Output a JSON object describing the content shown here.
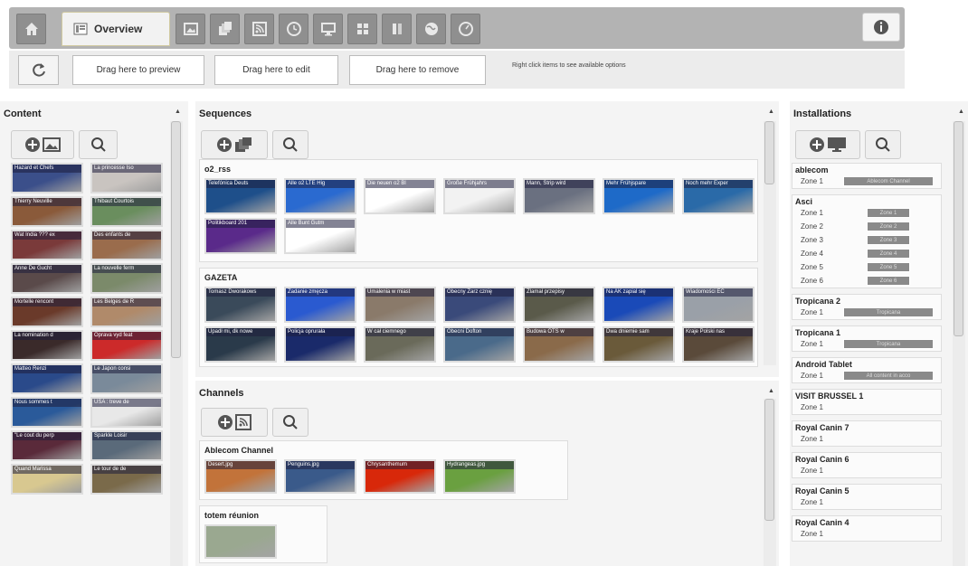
{
  "toolbar": {
    "overview_label": "Overview"
  },
  "drag": {
    "preview": "Drag here to preview",
    "edit": "Drag here to edit",
    "remove": "Drag here to remove",
    "hint": "Right click items to see available options"
  },
  "content": {
    "title": "Content",
    "items": [
      {
        "cap": "Hazard et Chefs",
        "c": "#3b4f8a"
      },
      {
        "cap": "La princesse Iso",
        "c": "#c9c4c0"
      },
      {
        "cap": "Thierry Neuville",
        "c": "#8a5a3a"
      },
      {
        "cap": "Thibaut Courtois",
        "c": "#6a8e5e"
      },
      {
        "cap": "Wat India ??? ex",
        "c": "#7a3a3a"
      },
      {
        "cap": "Des enfants de",
        "c": "#9a6c4c"
      },
      {
        "cap": "Anne De Gucht",
        "c": "#5a4a4a"
      },
      {
        "cap": "La nouvelle ferm",
        "c": "#7b8a6a"
      },
      {
        "cap": "Mortelle rencont",
        "c": "#6a3a2a"
      },
      {
        "cap": "Les Belges de R",
        "c": "#b08a6a"
      },
      {
        "cap": "La nomination d",
        "c": "#3a2a2a"
      },
      {
        "cap": "Oprava vyd feat",
        "c": "#cc2a2a"
      },
      {
        "cap": "Matteo Renzi",
        "c": "#2a4a8a"
      },
      {
        "cap": "Le Japon consi",
        "c": "#7a8a9a"
      },
      {
        "cap": "Nous sommes t",
        "c": "#2a5a9a"
      },
      {
        "cap": "USA : treve de",
        "c": "#e8e8e8"
      },
      {
        "cap": "\"Le cout du perp",
        "c": "#5a2a3a"
      },
      {
        "cap": "Sparkle Loisir",
        "c": "#5a6a7a"
      },
      {
        "cap": "Quand Marissa",
        "c": "#d8c890"
      },
      {
        "cap": "Le tour de de",
        "c": "#7a6a4a"
      }
    ]
  },
  "sequences": {
    "title": "Sequences",
    "groups": [
      {
        "name": "o2_rss",
        "tiles": [
          {
            "cap": "Telefónica Deuts",
            "c": "#1e4f8a"
          },
          {
            "cap": "Alle o2 LTE Hig",
            "c": "#2a6ad0"
          },
          {
            "cap": "Die neuen o2 Bl",
            "c": "#ffffff"
          },
          {
            "cap": "Große Frühjahrs",
            "c": "#f2f2f2"
          },
          {
            "cap": "Mann, Strip wird",
            "c": "#6a7080"
          },
          {
            "cap": "Mehr Frühjspare",
            "c": "#1e6ac8"
          },
          {
            "cap": "Noch mehr Exper",
            "c": "#2a6aa8"
          },
          {
            "cap": "Politikboard 201",
            "c": "#5a2a8a"
          },
          {
            "cap": "Alle Bunt Gutm",
            "c": "#ffffff"
          }
        ]
      },
      {
        "name": "GAZETA",
        "tiles": [
          {
            "cap": "Tomasz Dworakows",
            "c": "#3a4a5a"
          },
          {
            "cap": "Zadanie zmęcza",
            "c": "#2a5ad0"
          },
          {
            "cap": "Umalenia w miast",
            "c": "#8a7a6a"
          },
          {
            "cap": "Obecny Zarz cznię",
            "c": "#3a4a7a"
          },
          {
            "cap": "Zlamał przepisy",
            "c": "#5a5a4a"
          },
          {
            "cap": "Na AK zapial się",
            "c": "#1a4ab8"
          },
          {
            "cap": "Wiadomości EC",
            "c": "#9aa0a8"
          },
          {
            "cap": "Upadł mi, dk nowe",
            "c": "#2a3a4a"
          },
          {
            "cap": "Policja oprurała",
            "c": "#1a2a6a"
          },
          {
            "cap": "W cał ciemnego",
            "c": "#6a6a5a"
          },
          {
            "cap": "Obecni Dofton",
            "c": "#4a6a8a"
          },
          {
            "cap": "Budowa OTS w",
            "c": "#8a6a4a"
          },
          {
            "cap": "Dwa dniemie sam",
            "c": "#6a5a3a"
          },
          {
            "cap": "Kraje Polski nas",
            "c": "#5a4a3a"
          }
        ]
      }
    ]
  },
  "channels": {
    "title": "Channels",
    "groups": [
      {
        "name": "Ablecom Channel",
        "tiles": [
          {
            "cap": "Desert.jpg",
            "c": "#c2733a"
          },
          {
            "cap": "Penguins.jpg",
            "c": "#3a5a8a"
          },
          {
            "cap": "Chrysanthemum",
            "c": "#d8280a"
          },
          {
            "cap": "Hydrangeas.jpg",
            "c": "#6aa040"
          }
        ]
      },
      {
        "name": "totem réunion",
        "tiles": [
          {
            "cap": "",
            "c": "#9aa890"
          }
        ]
      }
    ]
  },
  "installations": {
    "title": "Installations",
    "items": [
      {
        "name": "ablecom",
        "zones": [
          {
            "label": "Zone 1",
            "value": "Ablecom Channel"
          }
        ]
      },
      {
        "name": "Asci",
        "zones": [
          {
            "label": "Zone 1",
            "value": "Zone 1"
          },
          {
            "label": "Zone 2",
            "value": "Zone 2"
          },
          {
            "label": "Zone 3",
            "value": "Zone 3"
          },
          {
            "label": "Zone 4",
            "value": "Zone 4"
          },
          {
            "label": "Zone 5",
            "value": "Zone 5"
          },
          {
            "label": "Zone 6",
            "value": "Zone 6"
          }
        ]
      },
      {
        "name": "Tropicana 2",
        "zones": [
          {
            "label": "Zone 1",
            "value": "Tropicana"
          }
        ]
      },
      {
        "name": "Tropicana 1",
        "zones": [
          {
            "label": "Zone 1",
            "value": "Tropicana"
          }
        ]
      },
      {
        "name": "Android Tablet",
        "zones": [
          {
            "label": "Zone 1",
            "value": "All content in acco"
          }
        ]
      },
      {
        "name": "VISIT BRUSSEL 1",
        "zones": [
          {
            "label": "Zone 1",
            "value": ""
          }
        ]
      },
      {
        "name": "Royal Canin 7",
        "zones": [
          {
            "label": "Zone 1",
            "value": ""
          }
        ]
      },
      {
        "name": "Royal Canin 6",
        "zones": [
          {
            "label": "Zone 1",
            "value": ""
          }
        ]
      },
      {
        "name": "Royal Canin 5",
        "zones": [
          {
            "label": "Zone 1",
            "value": ""
          }
        ]
      },
      {
        "name": "Royal Canin 4",
        "zones": [
          {
            "label": "Zone 1",
            "value": ""
          }
        ]
      }
    ]
  },
  "colors": {
    "toolbar": "#b3b3b3",
    "tab_active": "#f2f2f2",
    "panel": "#f4f4f4",
    "accent_blue": "#1e6ac8"
  }
}
